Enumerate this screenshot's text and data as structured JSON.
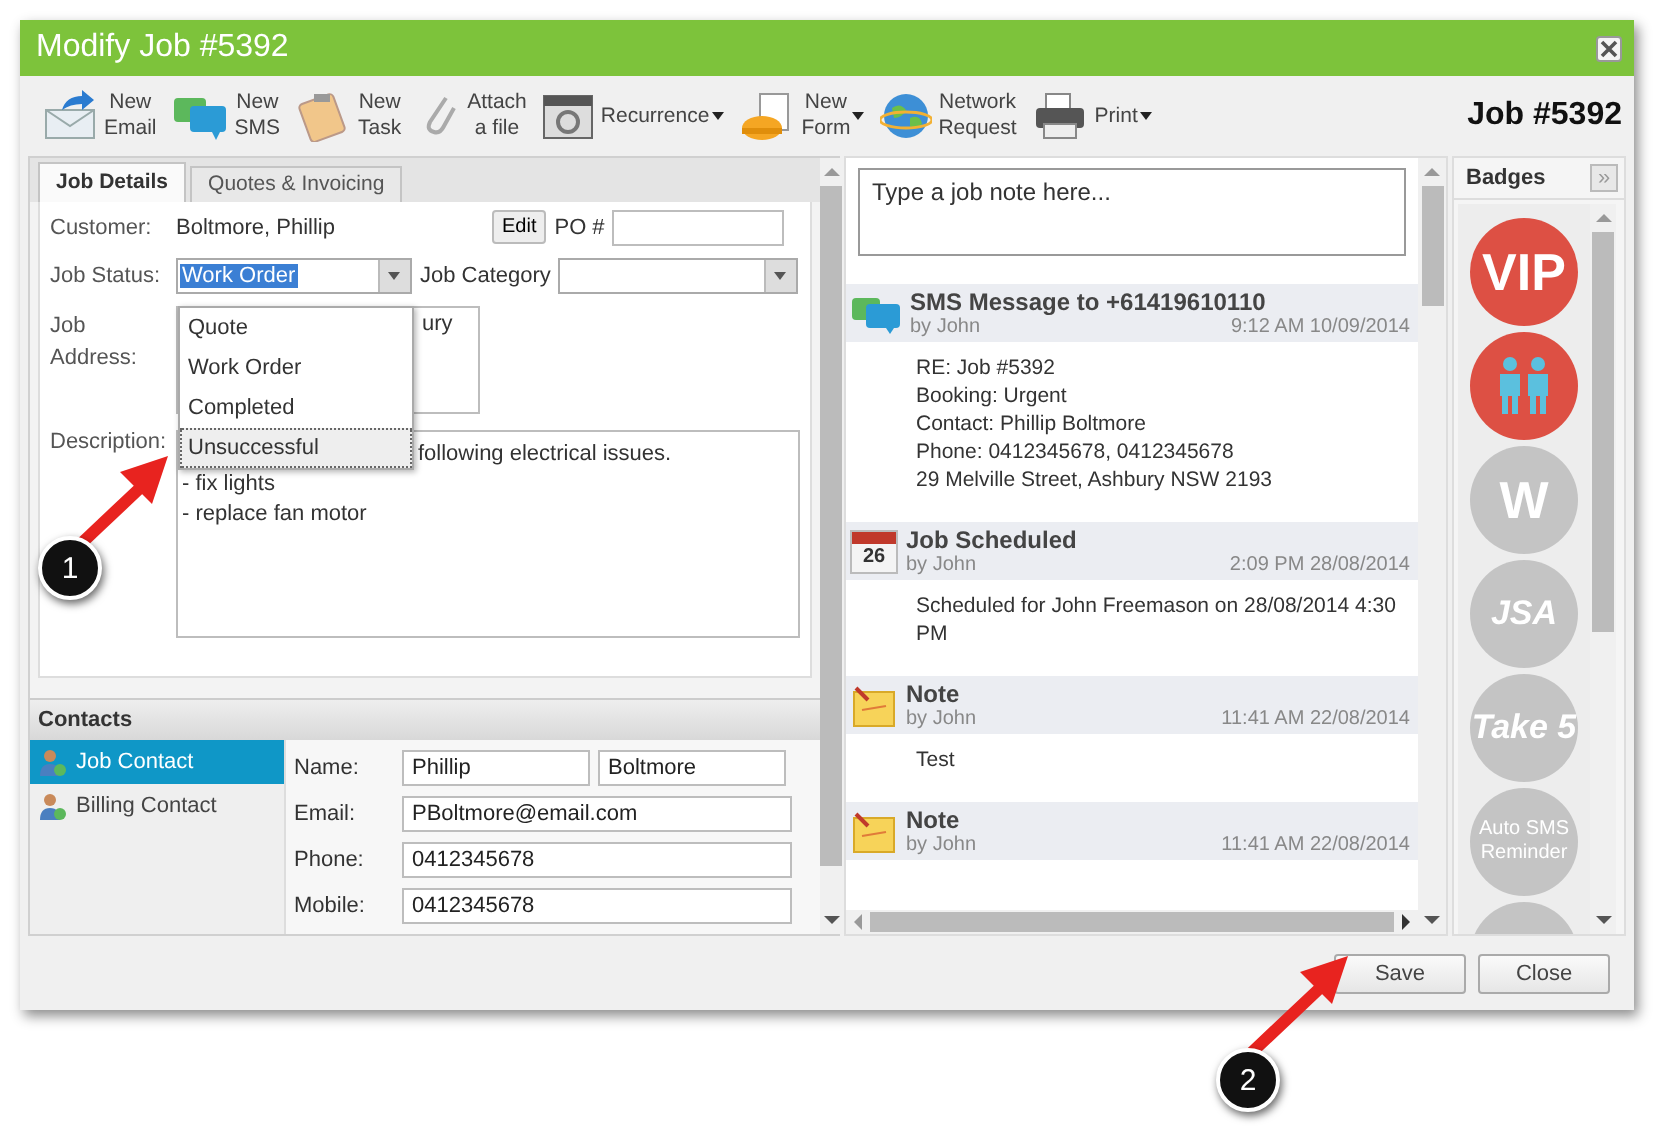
{
  "window": {
    "title": "Modify Job #5392",
    "job_number": "Job #5392"
  },
  "toolbar": [
    {
      "kind": "email",
      "lines": [
        "New",
        "Email"
      ],
      "dropdown": false
    },
    {
      "kind": "sms",
      "lines": [
        "New",
        "SMS"
      ],
      "dropdown": false
    },
    {
      "kind": "task",
      "lines": [
        "New",
        "Task"
      ],
      "dropdown": false
    },
    {
      "kind": "attach",
      "lines": [
        "Attach",
        "a file"
      ],
      "dropdown": false
    },
    {
      "kind": "recurrence",
      "lines": [
        "Recurrence"
      ],
      "dropdown": true
    },
    {
      "kind": "form",
      "lines": [
        "New",
        "Form"
      ],
      "dropdown": true
    },
    {
      "kind": "network",
      "lines": [
        "Network",
        "Request"
      ],
      "dropdown": false
    },
    {
      "kind": "print",
      "lines": [
        "Print"
      ],
      "dropdown": true
    }
  ],
  "tabs": [
    {
      "label": "Job Details",
      "selected": true
    },
    {
      "label": "Quotes & Invoicing",
      "selected": false
    }
  ],
  "form": {
    "customer_label": "Customer:",
    "customer": "Boltmore, Phillip",
    "edit_button": "Edit",
    "po_label": "PO #",
    "status_label": "Job Status:",
    "status_value": "Work Order",
    "category_label": "Job Category",
    "address_label": [
      "Job",
      "Address:"
    ],
    "address_visible": "ury",
    "description_label": "Description:",
    "description_visible": "following electrical issues.",
    "description_lines": [
      "- fix lights",
      "- replace fan motor"
    ]
  },
  "status_options": [
    {
      "label": "Quote",
      "focused": false
    },
    {
      "label": "Work Order",
      "focused": false
    },
    {
      "label": "Completed",
      "focused": false
    },
    {
      "label": "Unsuccessful",
      "focused": true
    }
  ],
  "contacts": {
    "title": "Contacts",
    "items": [
      {
        "label": "Job Contact",
        "selected": true
      },
      {
        "label": "Billing Contact",
        "selected": false
      }
    ],
    "name_label": "Name:",
    "first_name": "Phillip",
    "last_name": "Boltmore",
    "fields": [
      {
        "label": "Email:",
        "value": "PBoltmore@email.com"
      },
      {
        "label": "Phone:",
        "value": "0412345678"
      },
      {
        "label": "Mobile:",
        "value": "0412345678"
      }
    ]
  },
  "note_input": {
    "placeholder": "Type a job note here..."
  },
  "notes": [
    {
      "kind": "sms",
      "title": "SMS Message to +61419610110",
      "author": "by John",
      "time": "9:12 AM 10/09/2014",
      "lines": [
        "RE: Job #5392",
        "Booking: Urgent",
        "Contact: Phillip Boltmore",
        "Phone: 0412345678, 0412345678",
        "29 Melville Street, Ashbury NSW 2193"
      ]
    },
    {
      "kind": "calendar",
      "icon_text": "26",
      "title": "Job Scheduled",
      "author": "by John",
      "time": "2:09 PM 28/08/2014",
      "lines": [
        "Scheduled for John Freemason on 28/08/2014 4:30 PM"
      ]
    },
    {
      "kind": "note",
      "title": "Note",
      "author": "by John",
      "time": "11:41 AM 22/08/2014",
      "lines": [
        "Test"
      ]
    },
    {
      "kind": "note",
      "title": "Note",
      "author": "by John",
      "time": "11:41 AM 22/08/2014"
    }
  ],
  "badges_panel": {
    "title": "Badges",
    "collapse": "»"
  },
  "badges": [
    {
      "kind": "text",
      "label": "VIP",
      "on": true
    },
    {
      "kind": "people",
      "on": true
    },
    {
      "kind": "text",
      "label": "W",
      "on": false
    },
    {
      "kind": "italic",
      "label": "JSA",
      "on": false
    },
    {
      "kind": "italic",
      "label": "Take 5",
      "on": false
    },
    {
      "kind": "small",
      "label": "Auto SMS Reminder",
      "on": false
    }
  ],
  "buttons": [
    "Save",
    "Close"
  ],
  "annotations": [
    {
      "number": "1"
    },
    {
      "number": "2"
    }
  ]
}
